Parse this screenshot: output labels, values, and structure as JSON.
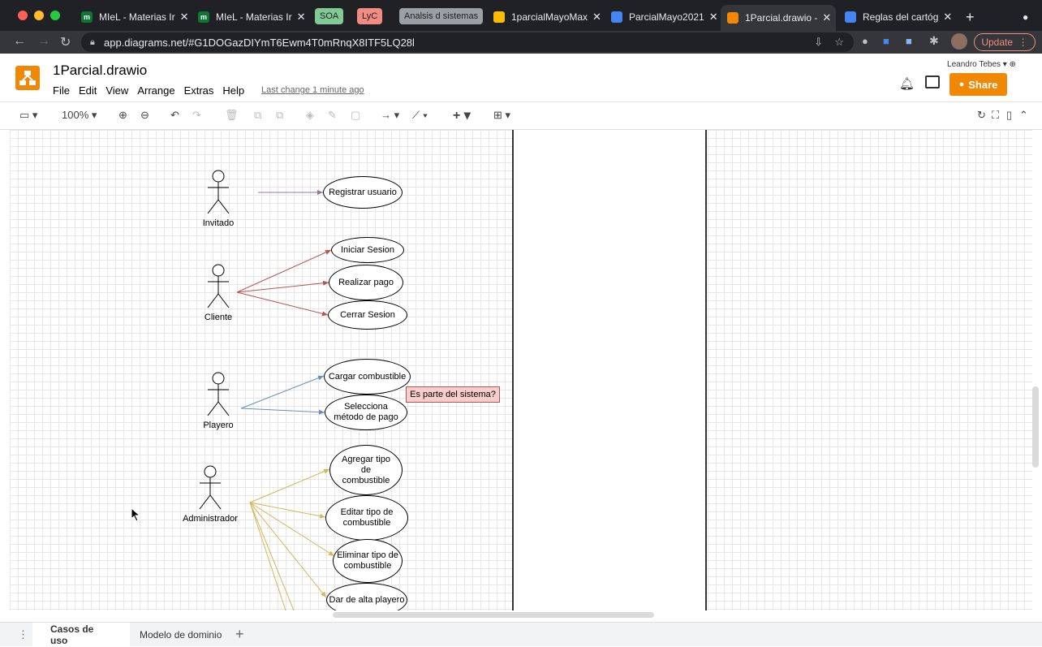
{
  "browser": {
    "tabs": [
      {
        "label": "MIeL - Materias Ir",
        "favicon": "m"
      },
      {
        "label": "MIeL - Materias Ir",
        "favicon": "m"
      },
      {
        "label": "1parcialMayoMax",
        "favicon": "drive-icon"
      },
      {
        "label": "ParcialMayo2021",
        "favicon": "docs-icon"
      },
      {
        "label": "1Parcial.drawio -",
        "favicon": "drawio-icon"
      },
      {
        "label": "Reglas del cartóg",
        "favicon": "docs-icon"
      }
    ],
    "pills": [
      {
        "label": "SOA",
        "color": "#81c995"
      },
      {
        "label": "LyC",
        "color": "#f28b82"
      },
      {
        "label": "Analsis d sistemas",
        "color": "#9aa0a6"
      }
    ],
    "url": "app.diagrams.net/#G1DOGazDIYmT6Ewm4T0mRnqX8ITF5LQ28l",
    "update_label": "Update"
  },
  "app": {
    "title": "1Parcial.drawio",
    "menu": [
      "File",
      "Edit",
      "View",
      "Arrange",
      "Extras",
      "Help"
    ],
    "last_change": "Last change 1 minute ago",
    "user": "Leandro Tebes",
    "share_label": "Share",
    "zoom": "100%"
  },
  "diagram": {
    "actors": [
      {
        "name": "Invitado"
      },
      {
        "name": "Cliente"
      },
      {
        "name": "Playero"
      },
      {
        "name": "Administrador"
      }
    ],
    "use_cases": {
      "registrar": "Registrar usuario",
      "iniciar": "Iniciar Sesion",
      "pago": "Realizar pago",
      "cerrar": "Cerrar Sesion",
      "cargar": "Cargar combustible",
      "metodo": "Selecciona método de pago",
      "agregar": "Agregar tipo de combustible",
      "editar": "Editar tipo de combustible",
      "eliminar": "Eliminar tipo de combustible",
      "alta": "Dar de alta playero"
    },
    "note": "Es parte del sistema?",
    "colors": {
      "invitado": "#9673a6",
      "cliente": "#b85450",
      "playero": "#6c8ebf",
      "admin": "#d6b656"
    }
  },
  "pages": {
    "tabs": [
      "Casos de uso",
      "Modelo de dominio"
    ]
  }
}
